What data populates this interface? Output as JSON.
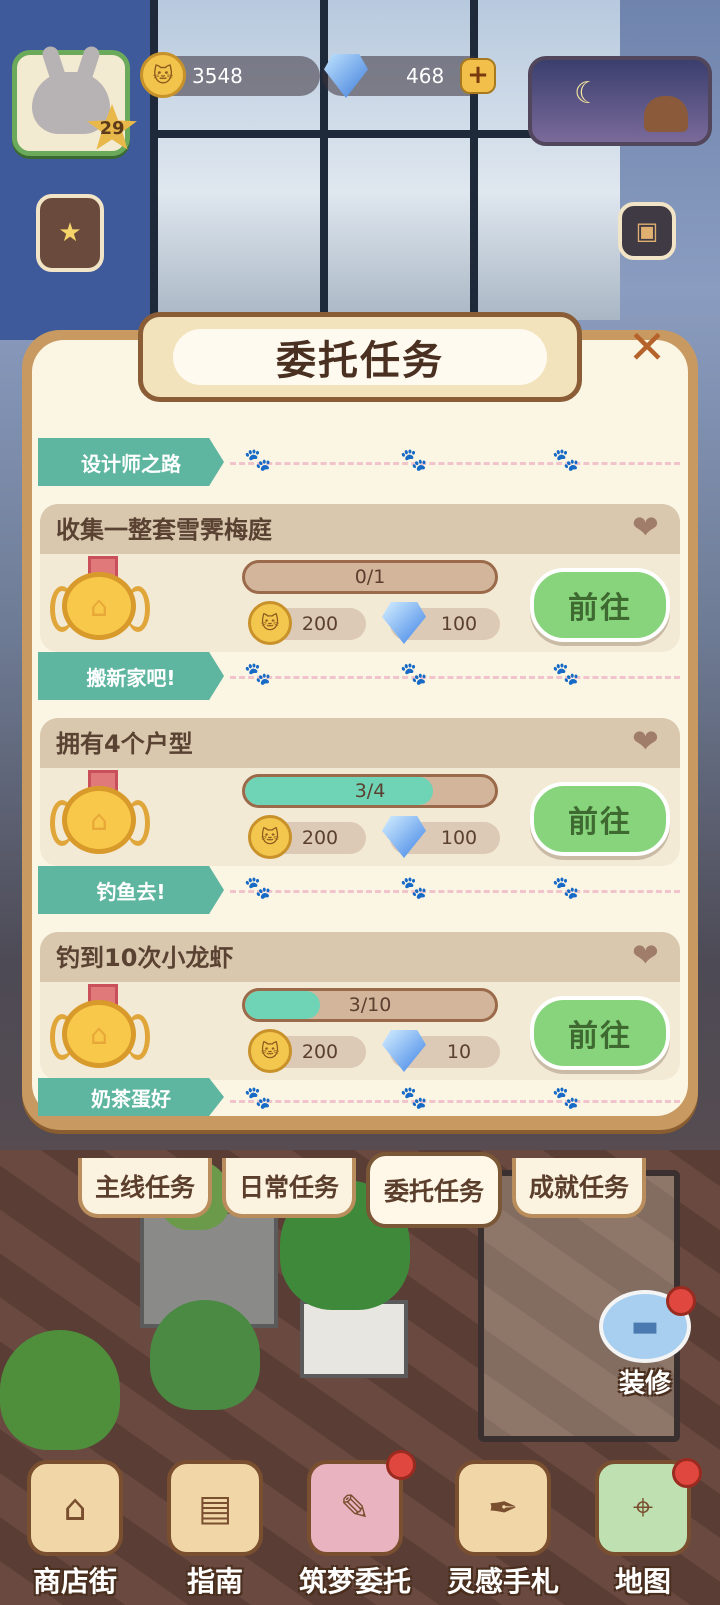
{
  "hud": {
    "level": "29",
    "coins": "3548",
    "gems": "468",
    "add_icon": "plus-icon",
    "night_icon": "moon-icon"
  },
  "panel": {
    "title": "委托任务",
    "close_icon": "close-icon"
  },
  "sections": [
    {
      "label": "设计师之路"
    },
    {
      "label": "搬新家吧!"
    },
    {
      "label": "钓鱼去!"
    },
    {
      "label": "奶茶蛋好"
    }
  ],
  "tasks": [
    {
      "title": "收集一整套雪霁梅庭",
      "progress_text": "0/1",
      "progress": 0.0,
      "coin_reward": "200",
      "gem_reward": "100",
      "button": "前往"
    },
    {
      "title": "拥有4个户型",
      "progress_text": "3/4",
      "progress": 0.75,
      "coin_reward": "200",
      "gem_reward": "100",
      "button": "前往"
    },
    {
      "title": "钓到10次小龙虾",
      "progress_text": "3/10",
      "progress": 0.3,
      "coin_reward": "200",
      "gem_reward": "10",
      "button": "前往"
    }
  ],
  "tabs": [
    {
      "label": "主线任务"
    },
    {
      "label": "日常任务"
    },
    {
      "label": "委托任务",
      "active": true
    },
    {
      "label": "成就任务"
    }
  ],
  "renovate": {
    "label": "装修"
  },
  "nav": [
    {
      "label": "商店街",
      "icon": "shop-icon"
    },
    {
      "label": "指南",
      "icon": "guide-book-icon"
    },
    {
      "label": "筑梦委托",
      "icon": "notebook-icon"
    },
    {
      "label": "灵感手札",
      "icon": "quill-book-icon"
    },
    {
      "label": "地图",
      "icon": "map-icon"
    }
  ],
  "colors": {
    "accent_green": "#88d47c",
    "progress_fill": "#6fd3b6",
    "ribbon": "#5fb6a0",
    "panel_border": "#c89a62"
  }
}
